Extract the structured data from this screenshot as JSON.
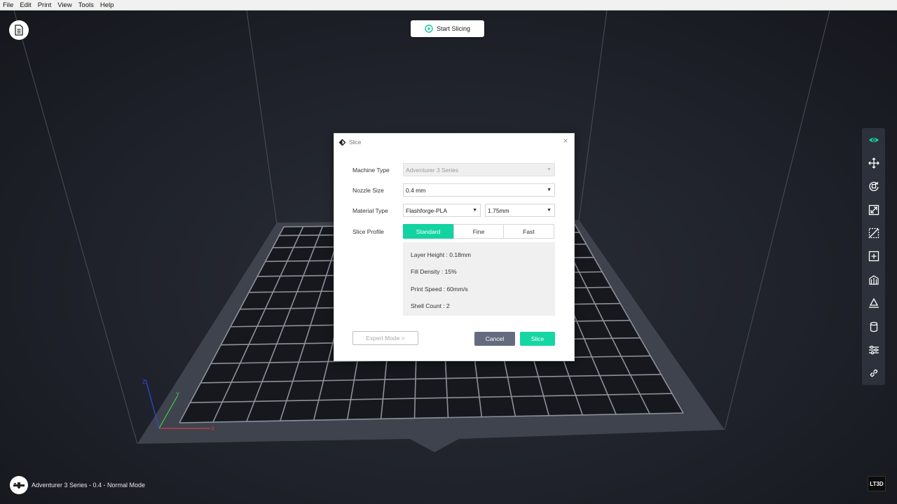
{
  "menu": [
    "File",
    "Edit",
    "Print",
    "View",
    "Tools",
    "Help"
  ],
  "toolbar_top": {
    "start_slicing": "Start Slicing"
  },
  "right_toolbar": [
    "eye-icon",
    "move-icon",
    "rotate-icon",
    "scale-icon",
    "cut-icon",
    "add-model-icon",
    "support-icon",
    "lay-flat-icon",
    "cylinder-icon",
    "settings-sliders-icon",
    "link-icon"
  ],
  "status": {
    "text": "Adventurer 3 Series - 0.4 - Normal Mode"
  },
  "brand_badge": "LT3D",
  "axes": {
    "x": "X",
    "y": "Y",
    "z": "Z"
  },
  "dialog": {
    "title": "Slice",
    "close": "×",
    "machine_type_label": "Machine Type",
    "machine_type_value": "Adventurer 3 Series",
    "nozzle_size_label": "Nozzle Size",
    "nozzle_size_value": "0.4 mm",
    "material_type_label": "Material Type",
    "material_value": "Flashforge-PLA",
    "diameter_value": "1.75mm",
    "slice_profile_label": "Slice Profile",
    "profiles": [
      "Standard",
      "Fine",
      "Fast"
    ],
    "active_profile": "Standard",
    "details": [
      "Layer Height : 0.18mm",
      "Fill Density : 15%",
      "Print Speed : 60mm/s",
      "Shell Count : 2"
    ],
    "expert_mode": "Expert Mode >",
    "cancel": "Cancel",
    "slice": "Slice"
  },
  "colors": {
    "accent": "#12d3a1",
    "cancel": "#646b7e",
    "bed": "#3f434d"
  }
}
